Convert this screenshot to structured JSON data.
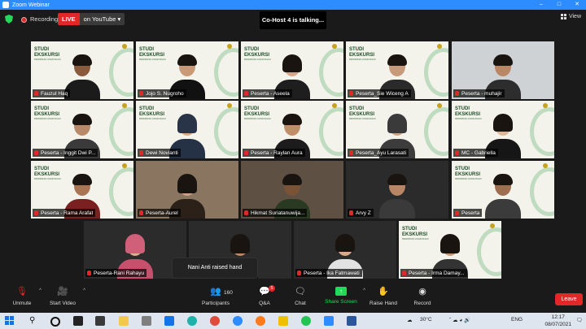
{
  "window": {
    "title": "Zoom Webinar"
  },
  "topbar": {
    "recording_label": "Recording",
    "live_badge": "LIVE",
    "live_destination": "on YouTube",
    "speaking_indicator": "Co-Host 4 is talking...",
    "view_label": "View"
  },
  "gallery": [
    {
      "name": "Fauzul Haq"
    },
    {
      "name": "Jojo S. Nugroho"
    },
    {
      "name": "Peserta - Aseela"
    },
    {
      "name": "Peserta_Sie Wiceng A"
    },
    {
      "name": "Peserta - muhajir"
    },
    {
      "name": "Peserta - Inggit Dwi P..."
    },
    {
      "name": "Dewi Novianti"
    },
    {
      "name": "Peserta - Raylan Aura"
    },
    {
      "name": "Peserta_Ayu Larasati"
    },
    {
      "name": "MC - Gabriella"
    },
    {
      "name": "Peserta - Rama Arafat"
    },
    {
      "name": "Peserta-Aurel"
    },
    {
      "name": "Hikmat Suriatanuwija..."
    },
    {
      "name": "Arvy Z"
    },
    {
      "name": "Peserta"
    },
    {
      "name": "Peserta-Rani Rahayu"
    },
    {
      "name": "Nani Anti"
    },
    {
      "name": "Peserta - Ika Fatmawati"
    },
    {
      "name": "Peserta - Irma Damay..."
    }
  ],
  "notification": {
    "text": "Nani Anti raised hand"
  },
  "toolbar": {
    "unmute": "Unmute",
    "start_video": "Start Video",
    "participants": "Participants",
    "participants_count": "160",
    "qa": "Q&A",
    "qa_badge": "5",
    "chat": "Chat",
    "share_screen": "Share Screen",
    "raise_hand": "Raise Hand",
    "record": "Record",
    "leave": "Leave",
    "accent_color": "#2d8cff",
    "share_color": "#23d959",
    "leave_color": "#e02828"
  },
  "taskbar": {
    "weather": "30°C",
    "language": "ENG",
    "time": "12:17",
    "date": "08/07/2021"
  },
  "tile_branding": {
    "line1": "STUDI",
    "line2": "EKSKURSI"
  }
}
